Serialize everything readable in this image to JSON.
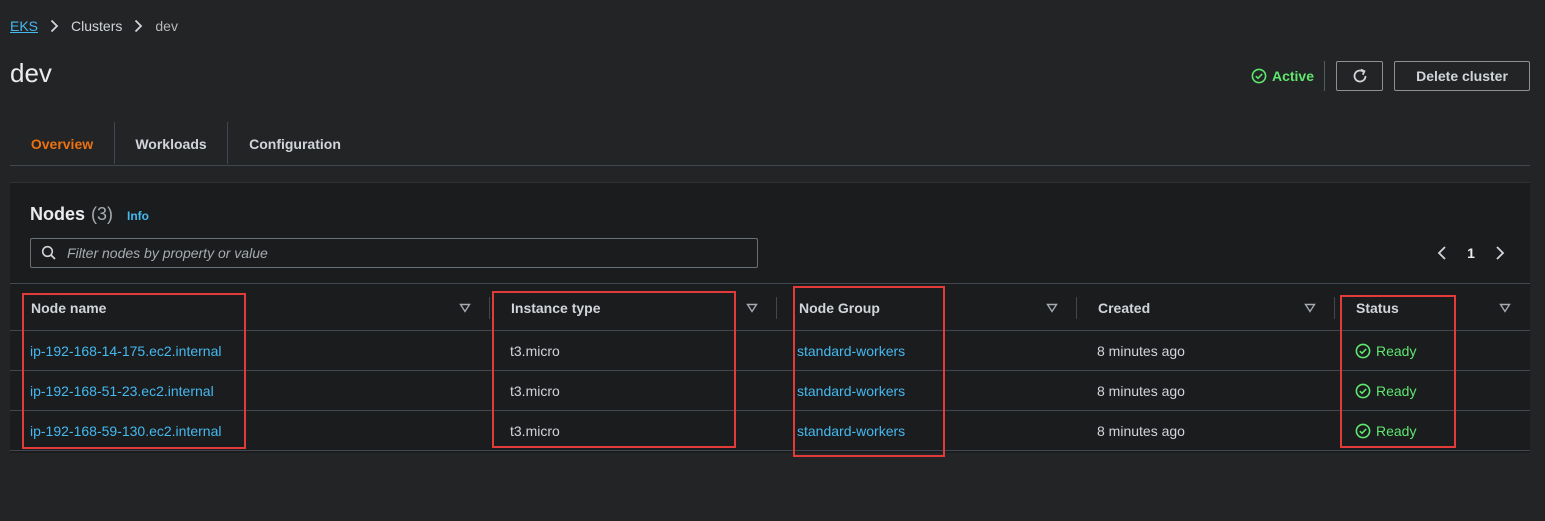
{
  "breadcrumb": {
    "items": [
      "EKS",
      "Clusters"
    ],
    "current": "dev"
  },
  "header": {
    "title": "dev",
    "status": "Active",
    "delete_label": "Delete cluster"
  },
  "tabs": [
    {
      "label": "Overview",
      "active": true
    },
    {
      "label": "Workloads",
      "active": false
    },
    {
      "label": "Configuration",
      "active": false
    }
  ],
  "nodes": {
    "title": "Nodes",
    "count": "(3)",
    "info": "Info",
    "filter_placeholder": "Filter nodes by property or value",
    "page": "1",
    "columns": [
      "Node name",
      "Instance type",
      "Node Group",
      "Created",
      "Status"
    ],
    "rows": [
      {
        "name": "ip-192-168-14-175.ec2.internal",
        "instance": "t3.micro",
        "group": "standard-workers",
        "created": "8 minutes ago",
        "status": "Ready"
      },
      {
        "name": "ip-192-168-51-23.ec2.internal",
        "instance": "t3.micro",
        "group": "standard-workers",
        "created": "8 minutes ago",
        "status": "Ready"
      },
      {
        "name": "ip-192-168-59-130.ec2.internal",
        "instance": "t3.micro",
        "group": "standard-workers",
        "created": "8 minutes ago",
        "status": "Ready"
      }
    ]
  },
  "icons": {
    "breadcrumb_separator": "chevron-right-icon",
    "status": "check-circle-icon",
    "refresh": "refresh-icon",
    "search": "search-icon",
    "sort": "caret-down-icon",
    "prev": "chevron-left-icon",
    "next": "chevron-right-icon"
  },
  "colors": {
    "link": "#44b9f0",
    "success": "#5fe66f",
    "active_tab": "#ec7211",
    "highlight": "#e33a3a"
  }
}
